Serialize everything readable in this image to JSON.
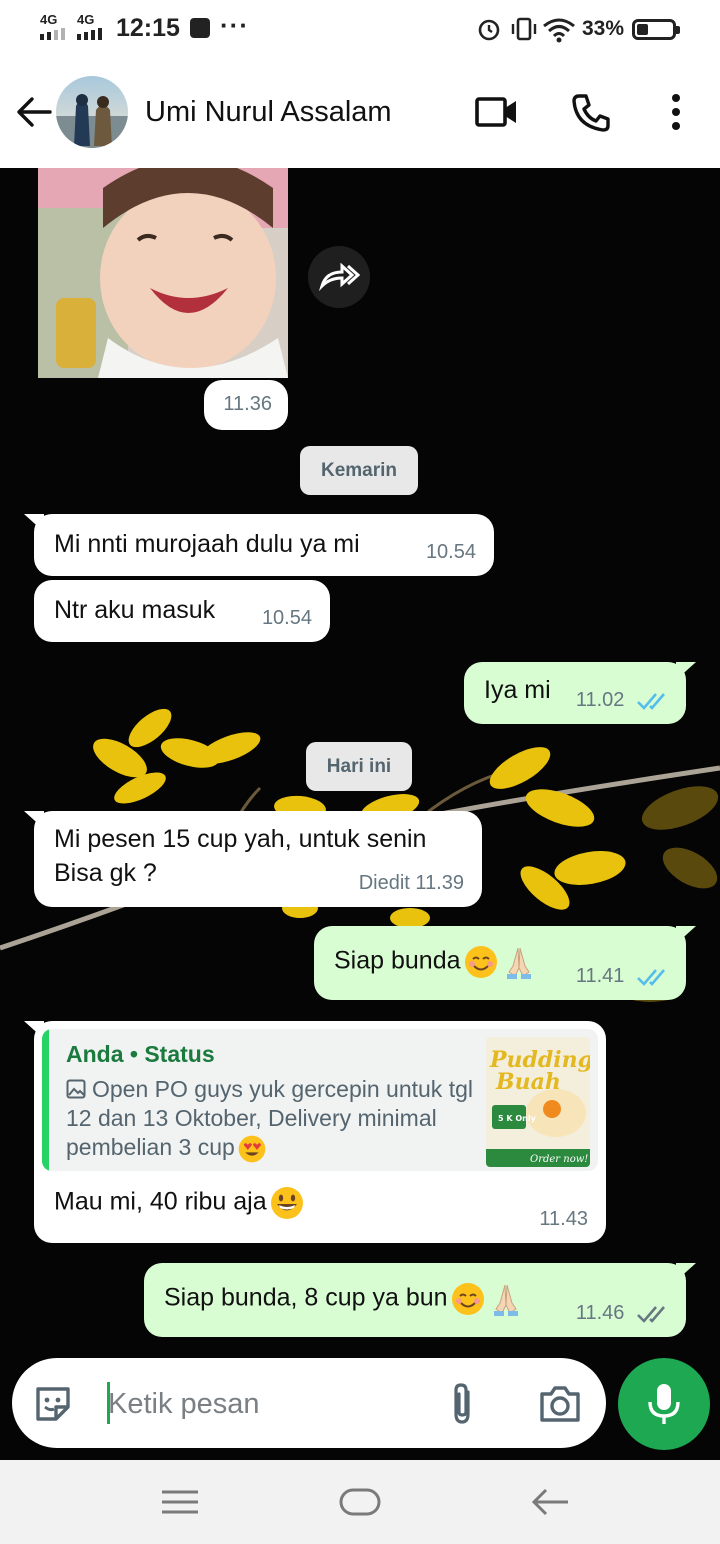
{
  "status_bar": {
    "network1": "4G",
    "network2": "4G",
    "time": "12:15",
    "battery": "33%",
    "battery_level": 0.33
  },
  "header": {
    "contact_name": "Umi Nurul Assalam",
    "back_icon": "arrow-left-icon",
    "video_icon": "video-call-icon",
    "call_icon": "phone-icon",
    "menu_icon": "more-vert-icon"
  },
  "messages": {
    "image_time": "11.36",
    "forward_icon": "forward-icon",
    "date_kemarin": "Kemarin",
    "m1_text": "Mi nnti murojaah dulu ya mi",
    "m1_time": "10.54",
    "m2_text": "Ntr aku masuk",
    "m2_time": "10.54",
    "m3_text": "Iya mi",
    "m3_time": "11.02",
    "date_hari_ini": "Hari ini",
    "m4_line1": "Mi pesen 15 cup yah, untuk senin",
    "m4_line2": "Bisa gk ?",
    "m4_time": "Diedit 11.39",
    "m5_text": "Siap bunda",
    "m5_time": "11.41",
    "m6_quote_title": "Anda • Status",
    "m6_quote_text": "Open PO guys yuk gercepin untuk tgl 12 dan 13 Oktober, Delivery minimal pembelian 3 cup",
    "m6_thumb_title1": "Pudding",
    "m6_thumb_title2": "Buah",
    "m6_thumb_price": "5 K Only",
    "m6_thumb_order": "Order now!",
    "m6_text": "Mau mi, 40 ribu aja",
    "m6_time": "11.43",
    "m7_text": "Siap bunda, 8 cup ya bun",
    "m7_time": "11.46"
  },
  "input": {
    "placeholder": "Ketik pesan",
    "sticker_icon": "sticker-icon",
    "attach_icon": "paperclip-icon",
    "camera_icon": "camera-icon",
    "mic_icon": "microphone-icon"
  },
  "nav": {
    "menu_icon": "menu-icon",
    "home_icon": "home-icon",
    "back_icon": "back-icon"
  },
  "colors": {
    "incoming": "#ffffff",
    "outgoing": "#d9fdd3",
    "read_ticks": "#53bdeb",
    "accent": "#1da851"
  }
}
